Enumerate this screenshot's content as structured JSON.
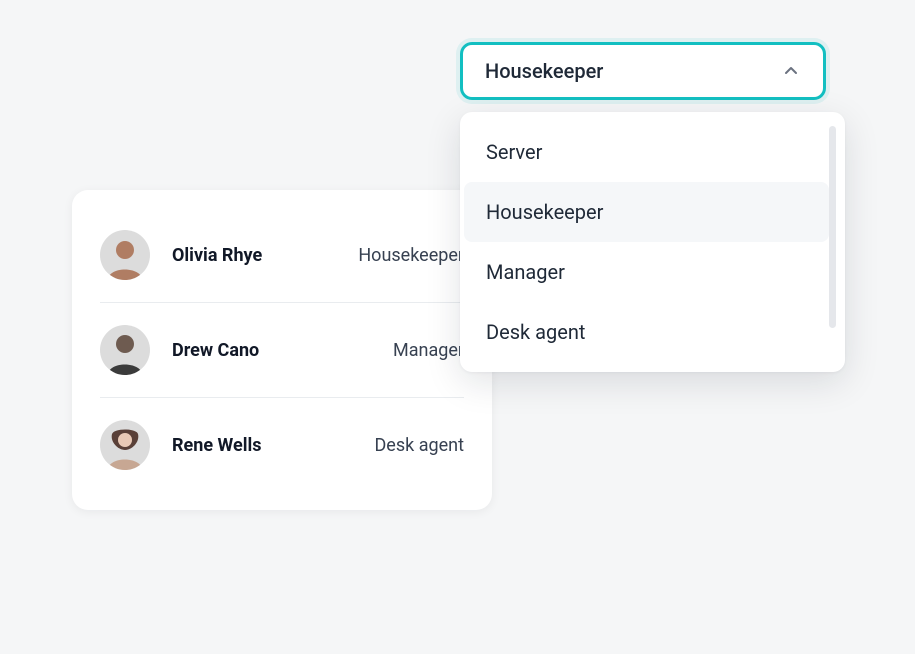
{
  "dropdown": {
    "selected_label": "Housekeeper",
    "options": [
      {
        "label": "Server"
      },
      {
        "label": "Housekeeper"
      },
      {
        "label": "Manager"
      },
      {
        "label": "Desk agent"
      }
    ]
  },
  "user_list": {
    "rows": [
      {
        "name": "Olivia Rhye",
        "role": "Housekeeper",
        "avatar_color_bg": "#e7d9d2",
        "avatar_color_fg": "#b07d63"
      },
      {
        "name": "Drew Cano",
        "role": "Manager",
        "avatar_color_bg": "#d6d9dc",
        "avatar_color_fg": "#6e5b50"
      },
      {
        "name": "Rene Wells",
        "role": "Desk agent",
        "avatar_color_bg": "#e0d8d2",
        "avatar_color_fg": "#5a4038"
      }
    ]
  },
  "colors": {
    "accent": "#12bfc1"
  }
}
